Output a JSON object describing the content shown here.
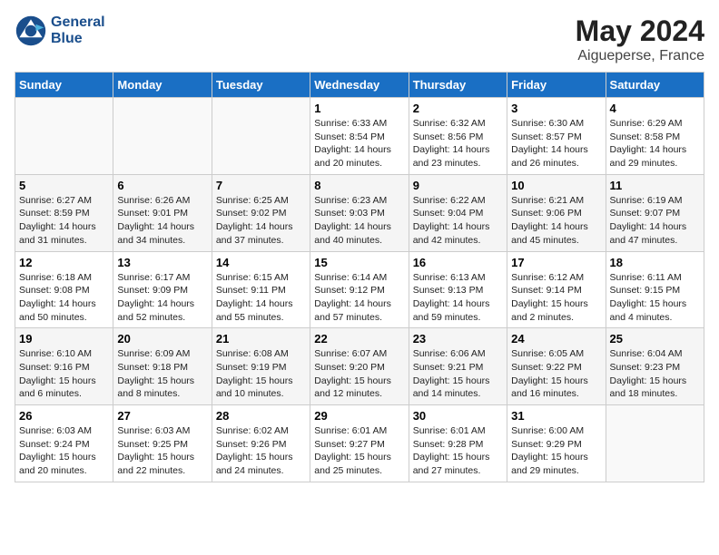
{
  "header": {
    "logo_general": "General",
    "logo_blue": "Blue",
    "month_year": "May 2024",
    "location": "Aigueperse, France"
  },
  "weekdays": [
    "Sunday",
    "Monday",
    "Tuesday",
    "Wednesday",
    "Thursday",
    "Friday",
    "Saturday"
  ],
  "weeks": [
    [
      {
        "day": "",
        "info": ""
      },
      {
        "day": "",
        "info": ""
      },
      {
        "day": "",
        "info": ""
      },
      {
        "day": "1",
        "info": "Sunrise: 6:33 AM\nSunset: 8:54 PM\nDaylight: 14 hours\nand 20 minutes."
      },
      {
        "day": "2",
        "info": "Sunrise: 6:32 AM\nSunset: 8:56 PM\nDaylight: 14 hours\nand 23 minutes."
      },
      {
        "day": "3",
        "info": "Sunrise: 6:30 AM\nSunset: 8:57 PM\nDaylight: 14 hours\nand 26 minutes."
      },
      {
        "day": "4",
        "info": "Sunrise: 6:29 AM\nSunset: 8:58 PM\nDaylight: 14 hours\nand 29 minutes."
      }
    ],
    [
      {
        "day": "5",
        "info": "Sunrise: 6:27 AM\nSunset: 8:59 PM\nDaylight: 14 hours\nand 31 minutes."
      },
      {
        "day": "6",
        "info": "Sunrise: 6:26 AM\nSunset: 9:01 PM\nDaylight: 14 hours\nand 34 minutes."
      },
      {
        "day": "7",
        "info": "Sunrise: 6:25 AM\nSunset: 9:02 PM\nDaylight: 14 hours\nand 37 minutes."
      },
      {
        "day": "8",
        "info": "Sunrise: 6:23 AM\nSunset: 9:03 PM\nDaylight: 14 hours\nand 40 minutes."
      },
      {
        "day": "9",
        "info": "Sunrise: 6:22 AM\nSunset: 9:04 PM\nDaylight: 14 hours\nand 42 minutes."
      },
      {
        "day": "10",
        "info": "Sunrise: 6:21 AM\nSunset: 9:06 PM\nDaylight: 14 hours\nand 45 minutes."
      },
      {
        "day": "11",
        "info": "Sunrise: 6:19 AM\nSunset: 9:07 PM\nDaylight: 14 hours\nand 47 minutes."
      }
    ],
    [
      {
        "day": "12",
        "info": "Sunrise: 6:18 AM\nSunset: 9:08 PM\nDaylight: 14 hours\nand 50 minutes."
      },
      {
        "day": "13",
        "info": "Sunrise: 6:17 AM\nSunset: 9:09 PM\nDaylight: 14 hours\nand 52 minutes."
      },
      {
        "day": "14",
        "info": "Sunrise: 6:15 AM\nSunset: 9:11 PM\nDaylight: 14 hours\nand 55 minutes."
      },
      {
        "day": "15",
        "info": "Sunrise: 6:14 AM\nSunset: 9:12 PM\nDaylight: 14 hours\nand 57 minutes."
      },
      {
        "day": "16",
        "info": "Sunrise: 6:13 AM\nSunset: 9:13 PM\nDaylight: 14 hours\nand 59 minutes."
      },
      {
        "day": "17",
        "info": "Sunrise: 6:12 AM\nSunset: 9:14 PM\nDaylight: 15 hours\nand 2 minutes."
      },
      {
        "day": "18",
        "info": "Sunrise: 6:11 AM\nSunset: 9:15 PM\nDaylight: 15 hours\nand 4 minutes."
      }
    ],
    [
      {
        "day": "19",
        "info": "Sunrise: 6:10 AM\nSunset: 9:16 PM\nDaylight: 15 hours\nand 6 minutes."
      },
      {
        "day": "20",
        "info": "Sunrise: 6:09 AM\nSunset: 9:18 PM\nDaylight: 15 hours\nand 8 minutes."
      },
      {
        "day": "21",
        "info": "Sunrise: 6:08 AM\nSunset: 9:19 PM\nDaylight: 15 hours\nand 10 minutes."
      },
      {
        "day": "22",
        "info": "Sunrise: 6:07 AM\nSunset: 9:20 PM\nDaylight: 15 hours\nand 12 minutes."
      },
      {
        "day": "23",
        "info": "Sunrise: 6:06 AM\nSunset: 9:21 PM\nDaylight: 15 hours\nand 14 minutes."
      },
      {
        "day": "24",
        "info": "Sunrise: 6:05 AM\nSunset: 9:22 PM\nDaylight: 15 hours\nand 16 minutes."
      },
      {
        "day": "25",
        "info": "Sunrise: 6:04 AM\nSunset: 9:23 PM\nDaylight: 15 hours\nand 18 minutes."
      }
    ],
    [
      {
        "day": "26",
        "info": "Sunrise: 6:03 AM\nSunset: 9:24 PM\nDaylight: 15 hours\nand 20 minutes."
      },
      {
        "day": "27",
        "info": "Sunrise: 6:03 AM\nSunset: 9:25 PM\nDaylight: 15 hours\nand 22 minutes."
      },
      {
        "day": "28",
        "info": "Sunrise: 6:02 AM\nSunset: 9:26 PM\nDaylight: 15 hours\nand 24 minutes."
      },
      {
        "day": "29",
        "info": "Sunrise: 6:01 AM\nSunset: 9:27 PM\nDaylight: 15 hours\nand 25 minutes."
      },
      {
        "day": "30",
        "info": "Sunrise: 6:01 AM\nSunset: 9:28 PM\nDaylight: 15 hours\nand 27 minutes."
      },
      {
        "day": "31",
        "info": "Sunrise: 6:00 AM\nSunset: 9:29 PM\nDaylight: 15 hours\nand 29 minutes."
      },
      {
        "day": "",
        "info": ""
      }
    ]
  ]
}
